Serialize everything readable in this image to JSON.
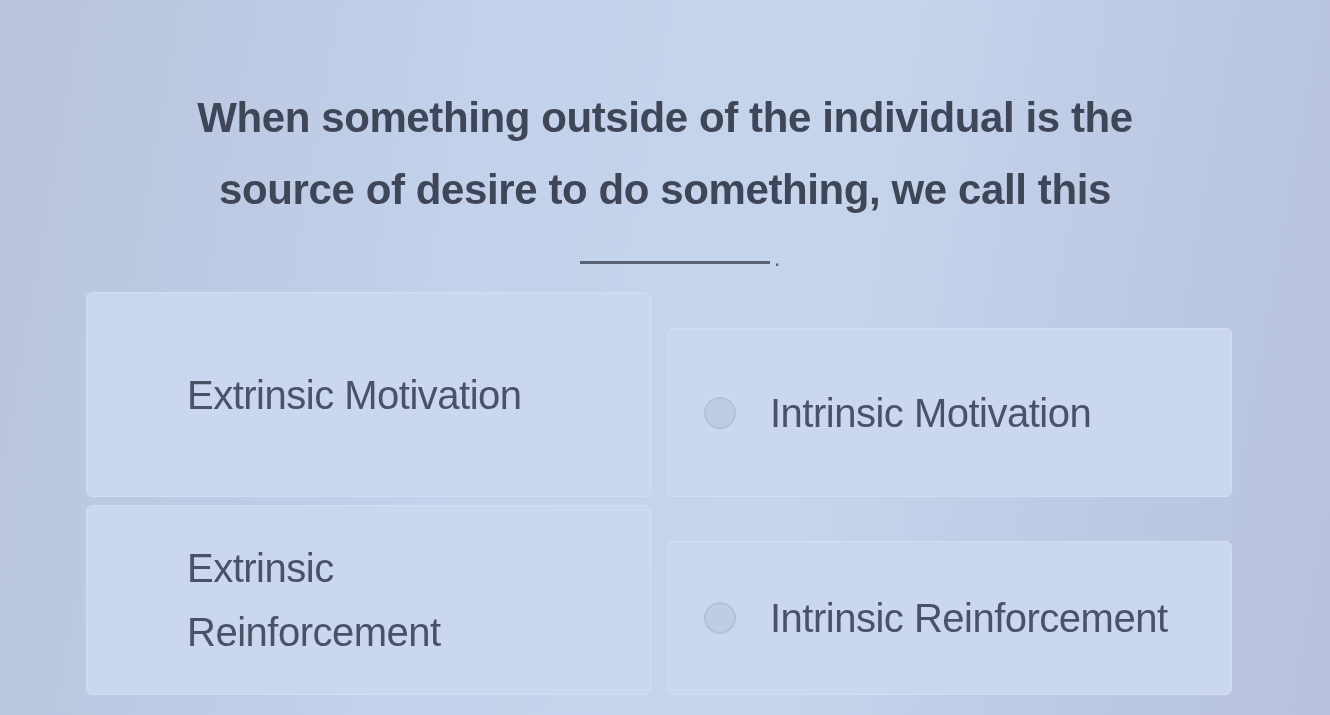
{
  "question": {
    "text": "When something outside of the individual is the source of desire to do something, we call this",
    "after_blank": "."
  },
  "options": [
    {
      "text": "Extrinsic Motivation",
      "kind": "plain",
      "selected": false
    },
    {
      "text": "Intrinsic Motivation",
      "kind": "radio",
      "selected": false
    },
    {
      "text": "Extrinsic\nReinforcement",
      "kind": "plain",
      "selected": false
    },
    {
      "text": "Intrinsic Reinforcement",
      "kind": "radio",
      "selected": false
    }
  ]
}
